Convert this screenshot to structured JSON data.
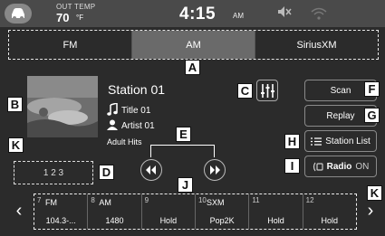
{
  "status": {
    "outside_temp_label": "OUT TEMP",
    "outside_temp_value": "70",
    "outside_temp_unit": "°F",
    "time": "4:15",
    "ampm": "AM"
  },
  "tabs": [
    {
      "label": "FM",
      "active": false
    },
    {
      "label": "AM",
      "active": true
    },
    {
      "label": "SiriusXM",
      "active": false
    }
  ],
  "now_playing": {
    "station": "Station 01",
    "title": "Title 01",
    "artist": "Artist 01",
    "genre": "Adult Hits"
  },
  "buttons": {
    "scan": "Scan",
    "replay": "Replay",
    "station_list": "Station List",
    "radio": "Radio",
    "radio_state": "ON",
    "direct_tune": "1 2 3"
  },
  "presets": [
    {
      "num": "7",
      "band": "FM",
      "value": "104.3-..."
    },
    {
      "num": "8",
      "band": "AM",
      "value": "1480"
    },
    {
      "num": "9",
      "band": "",
      "value": "Hold"
    },
    {
      "num": "10",
      "band": "SXM",
      "value": "Pop2K"
    },
    {
      "num": "11",
      "band": "",
      "value": "Hold"
    },
    {
      "num": "12",
      "band": "",
      "value": "Hold"
    }
  ],
  "callouts": {
    "A": "A",
    "B": "B",
    "C": "C",
    "D": "D",
    "E": "E",
    "F": "F",
    "G": "G",
    "H": "H",
    "I": "I",
    "J": "J",
    "K": "K"
  },
  "arrows": {
    "left": "‹",
    "right": "›"
  },
  "icons": {
    "car": "car-icon",
    "mute": "mute-icon",
    "wifi": "wifi-icon",
    "note": "music-note-icon",
    "artist": "person-icon",
    "eq": "equalizer-icon",
    "list": "list-icon",
    "radio": "radio-icon",
    "seek_back": "rewind-icon",
    "seek_fwd": "fast-forward-icon"
  },
  "colors": {
    "background": "#2b2b2b",
    "statusbar": "#4a4a4a",
    "active_tab": "#6a6a6a"
  }
}
